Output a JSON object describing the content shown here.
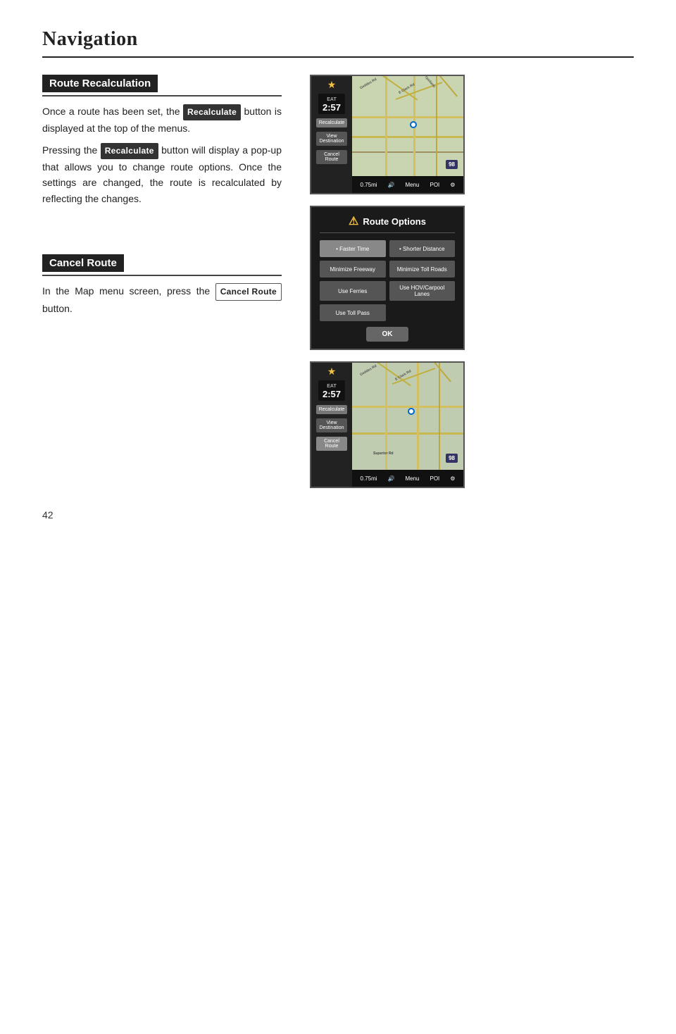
{
  "page": {
    "title": "Navigation",
    "page_number": "42"
  },
  "section1": {
    "heading": "Route Recalculation",
    "para1": "Once a route has been set, the",
    "btn1_label": "Recalculate",
    "para1b": "button is displayed at the top of the menus.",
    "para2_start": "Pressing the",
    "btn2_label": "Recalculate",
    "para2_end": "button will display a pop-up that allows you to change route options. Once the settings are changed, the route is recalculated by reflecting the changes."
  },
  "section2": {
    "heading": "Cancel Route",
    "para1": "In the Map menu screen, press the",
    "btn_label": "Cancel Route",
    "para1b": "button."
  },
  "map1": {
    "time": "2:57",
    "buttons": [
      "Recalculate",
      "View\nDestination",
      "Cancel\nRoute"
    ],
    "bottom_bar": [
      "0.75mi",
      "🔊",
      "Menu",
      "POI",
      "⚙"
    ]
  },
  "route_options": {
    "title": "Route Options",
    "options": [
      {
        "label": "Faster Time",
        "selected": true
      },
      {
        "label": "Shorter Distance",
        "selected": false
      },
      {
        "label": "Minimize Freeway",
        "selected": false
      },
      {
        "label": "Minimize Toll Roads",
        "selected": false
      },
      {
        "label": "Use Ferries",
        "selected": false
      },
      {
        "label": "Use HOV/Carpool Lanes",
        "selected": false
      },
      {
        "label": "Use Toll Pass",
        "selected": false
      }
    ],
    "ok_label": "OK"
  },
  "map2": {
    "time": "2:57",
    "buttons": [
      "Recalculate",
      "View\nDestination",
      "Cancel\nRoute"
    ],
    "bottom_bar": [
      "0.75mi",
      "🔊",
      "Menu",
      "POI",
      "⚙"
    ]
  }
}
